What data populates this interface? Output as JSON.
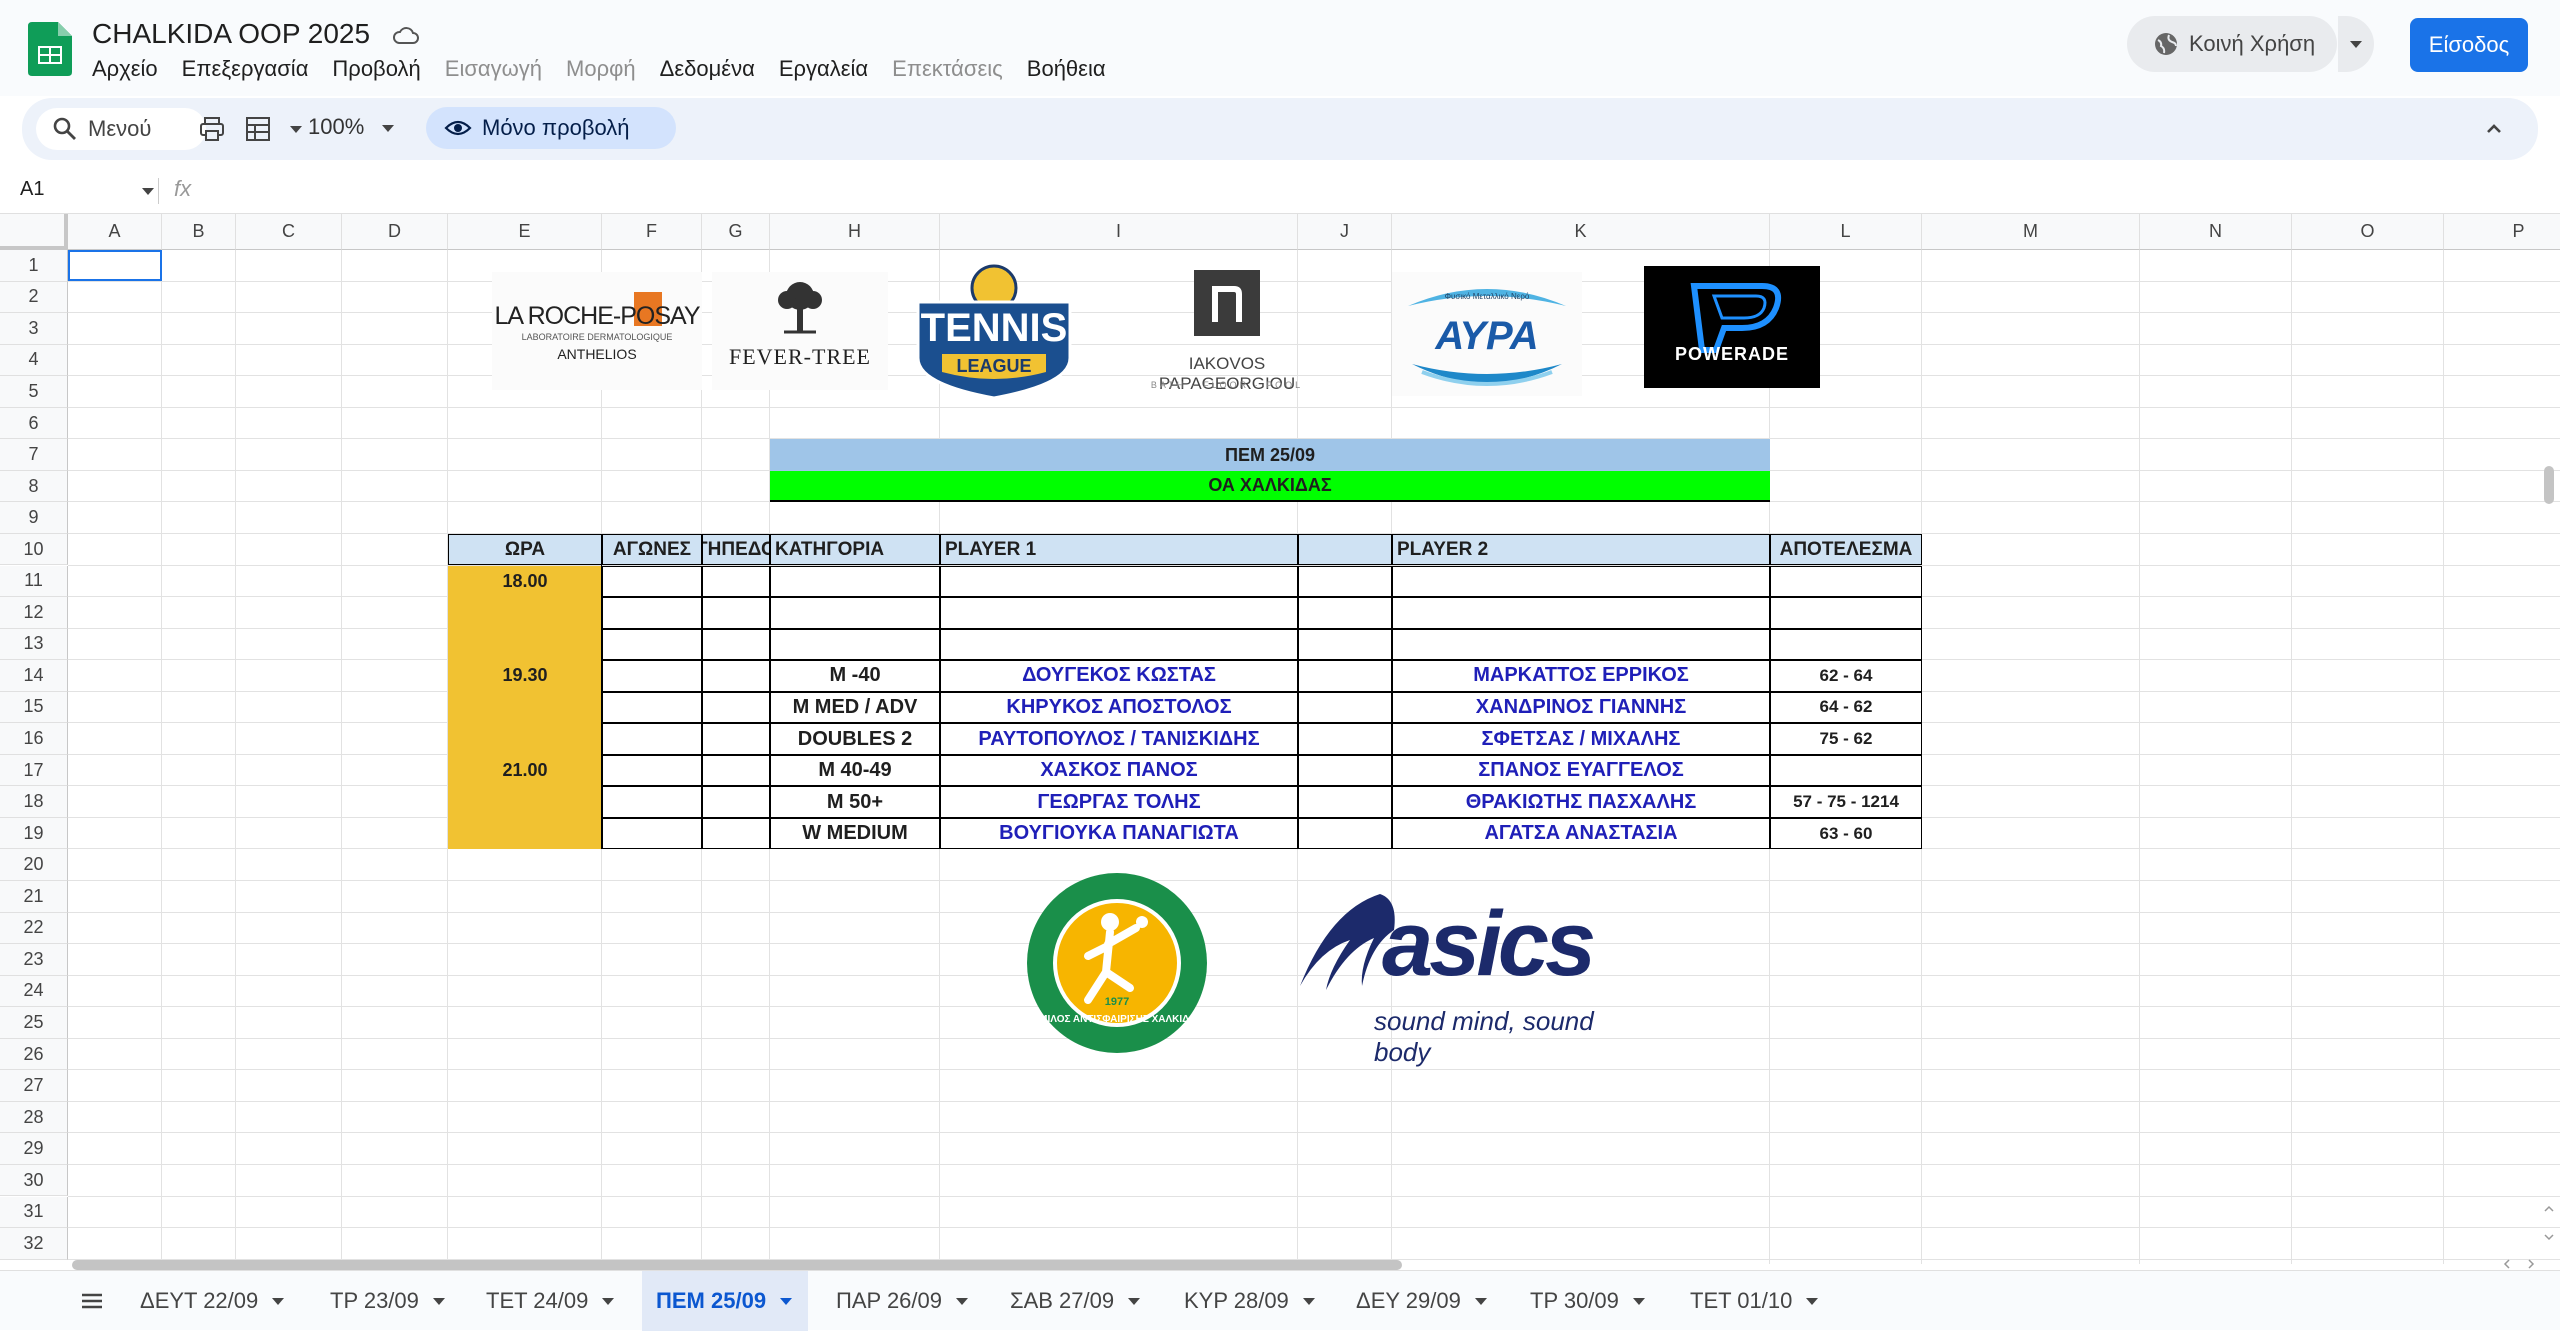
{
  "app": {
    "doc_title": "CHALKIDA OOP 2025",
    "menu": [
      "Αρχείο",
      "Επεξεργασία",
      "Προβολή",
      "Εισαγωγή",
      "Μορφή",
      "Δεδομένα",
      "Εργαλεία",
      "Επεκτάσεις",
      "Βοήθεια"
    ],
    "share_label": "Κοινή Χρήση",
    "signin_label": "Είσοδος"
  },
  "toolbar": {
    "search_label": "Μενού",
    "zoom": "100%",
    "view_only_label": "Μόνο προβολή"
  },
  "formula_bar": {
    "name_box": "A1",
    "fx": "fx"
  },
  "grid": {
    "columns": [
      "A",
      "B",
      "C",
      "D",
      "E",
      "F",
      "G",
      "H",
      "I",
      "J",
      "K",
      "L",
      "M",
      "N",
      "O",
      "P"
    ],
    "rows": [
      "1",
      "2",
      "3",
      "4",
      "5",
      "6",
      "7",
      "8",
      "9",
      "10",
      "11",
      "12",
      "13",
      "14",
      "15",
      "16",
      "17",
      "18",
      "19",
      "20",
      "21",
      "22",
      "23",
      "24",
      "25",
      "26",
      "27",
      "28",
      "29",
      "30",
      "31",
      "32"
    ]
  },
  "sheet": {
    "date_banner": "ΠΕΜ 25/09",
    "venue_banner": "ΟΑ ΧΑΛΚΙΔΑΣ",
    "headers": {
      "time": "ΩΡΑ",
      "matches": "ΑΓΩΝΕΣ",
      "court": "ΓΗΠΕΔΟ",
      "category": "ΚΑΤΗΓΟΡΙΑ",
      "player1": "PLAYER 1",
      "player2": "PLAYER 2",
      "result": "ΑΠΟΤΕΛΕΣΜΑ"
    },
    "rows": [
      {
        "time": "18.00",
        "category": "",
        "player1": "",
        "player2": "",
        "result": ""
      },
      {
        "time": "",
        "category": "",
        "player1": "",
        "player2": "",
        "result": ""
      },
      {
        "time": "",
        "category": "",
        "player1": "",
        "player2": "",
        "result": ""
      },
      {
        "time": "19.30",
        "category": "M -40",
        "player1": "ΔΟΥΓΕΚΟΣ ΚΩΣΤΑΣ",
        "player2": "ΜΑΡΚΑΤΤΟΣ ΕΡΡΙΚΟΣ",
        "result": "62 - 64"
      },
      {
        "time": "",
        "category": "M MED / ADV",
        "player1": "ΚΗΡΥΚΟΣ ΑΠΟΣΤΟΛΟΣ",
        "player2": "ΧΑΝΔΡΙΝΟΣ ΓΙΑΝΝΗΣ",
        "result": "64 - 62"
      },
      {
        "time": "",
        "category": "DOUBLES 2",
        "player1": "ΡΑΥΤΟΠΟΥΛΟΣ / ΤΑΝΙΣΚΙΔΗΣ",
        "player2": "ΣΦΕΤΣΑΣ / ΜΙΧΑΛΗΣ",
        "result": "75 - 62"
      },
      {
        "time": "21.00",
        "category": "M 40-49",
        "player1": "ΧΑΣΚΟΣ ΠΑΝΟΣ",
        "player2": "ΣΠΑΝΟΣ ΕΥΑΓΓΕΛΟΣ",
        "result": ""
      },
      {
        "time": "",
        "category": "M 50+",
        "player1": "ΓΕΩΡΓΑΣ ΤΟΛΗΣ",
        "player2": "ΘΡΑΚΙΩΤΗΣ ΠΑΣΧΑΛΗΣ",
        "result": "57 - 75 - 1214"
      },
      {
        "time": "",
        "category": "W MEDIUM",
        "player1": "ΒΟΥΓΙΟΥΚΑ ΠΑΝΑΓΙΩΤΑ",
        "player2": "ΑΓΑΤΣΑ ΑΝΑΣΤΑΣΙΑ",
        "result": "63 - 60"
      }
    ]
  },
  "sponsors": {
    "laroche_line1": "LA ROCHE-POSAY",
    "laroche_line2": "LABORATOIRE DERMATOLOGIQUE",
    "laroche_line3": "ANTHELIOS",
    "fevertree": "FEVER-TREE",
    "tennis_line1": "TENNIS",
    "tennis_line2": "LEAGUE",
    "iakovos_line1": "IAKOVOS PAPAGEORGIOU",
    "iakovos_line2": "BATH · FLOOR · POOL",
    "avra_small": "Φυσικό Μεταλλικό Νερό",
    "avra": "ΑΥΡΑ",
    "powerade": "POWERADE",
    "club_text": "ΟΜΙΛΟΣ ΑΝΤΙΣΦΑΙΡΙΣΗΣ ΧΑΛΚΙΔΑΣ",
    "club_year": "1977",
    "asics": "asics",
    "asics_tag": "sound mind, sound body"
  },
  "tabs": [
    "ΔΕΥΤ 22/09",
    "ΤΡ 23/09",
    "ΤΕΤ 24/09",
    "ΠΕΜ 25/09",
    "ΠΑΡ 26/09",
    "ΣΑΒ 27/09",
    "ΚΥΡ 28/09",
    "ΔΕΥ 29/09",
    "ΤΡ 30/09",
    "ΤΕΤ 01/10"
  ],
  "active_tab": "ΠΕΜ 25/09",
  "colors": {
    "time_fill": "#f1c232",
    "header_fill": "#cfe2f3",
    "banner_blue": "#9fc5e8",
    "banner_green": "#00ff00",
    "player_blue": "#1f1fb8"
  }
}
